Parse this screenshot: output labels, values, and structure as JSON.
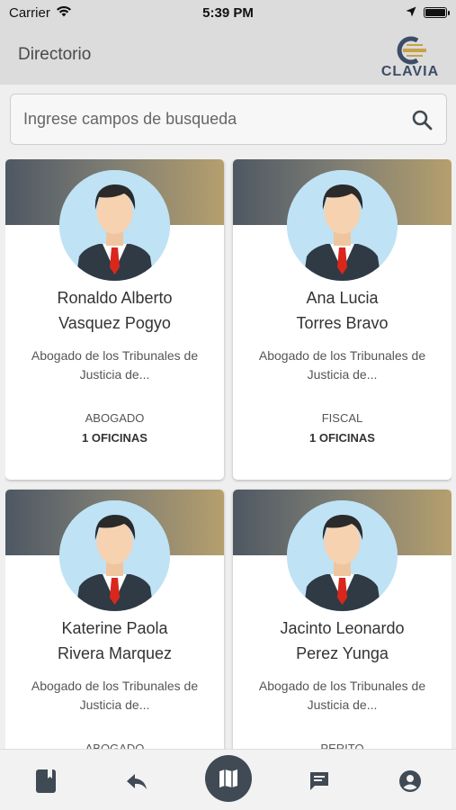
{
  "status_bar": {
    "carrier": "Carrier",
    "time": "5:39 PM"
  },
  "header": {
    "title": "Directorio",
    "logo_text": "CLAVIA"
  },
  "search": {
    "placeholder": "Ingrese campos de busqueda",
    "value": ""
  },
  "cards": [
    {
      "name_line1": "Ronaldo Alberto",
      "name_line2": "Vasquez Pogyo",
      "desc_line1": "Abogado de los Tribunales de",
      "desc_line2": "Justicia de...",
      "role": "ABOGADO",
      "offices": "1 OFICINAS"
    },
    {
      "name_line1": "Ana Lucia",
      "name_line2": "Torres Bravo",
      "desc_line1": "Abogado de los Tribunales de",
      "desc_line2": "Justicia de...",
      "role": "FISCAL",
      "offices": "1 OFICINAS"
    },
    {
      "name_line1": "Katerine Paola",
      "name_line2": "Rivera Marquez",
      "desc_line1": "Abogado de los Tribunales de",
      "desc_line2": "Justicia de...",
      "role": "ABOGADO",
      "offices": ""
    },
    {
      "name_line1": "Jacinto Leonardo",
      "name_line2": "Perez Yunga",
      "desc_line1": "Abogado de los Tribunales de",
      "desc_line2": "Justicia de...",
      "role": "PERITO",
      "offices": ""
    }
  ],
  "bottom_nav": {
    "icons": [
      "book-icon",
      "reply-icon",
      "map-icon",
      "chat-icon",
      "account-icon"
    ]
  },
  "colors": {
    "banner_start": "#4e5863",
    "banner_end": "#b59f6d",
    "nav_center_bg": "#3f4a54",
    "icon_dark": "#3f4a54",
    "header_bg": "#dcdcdc"
  }
}
